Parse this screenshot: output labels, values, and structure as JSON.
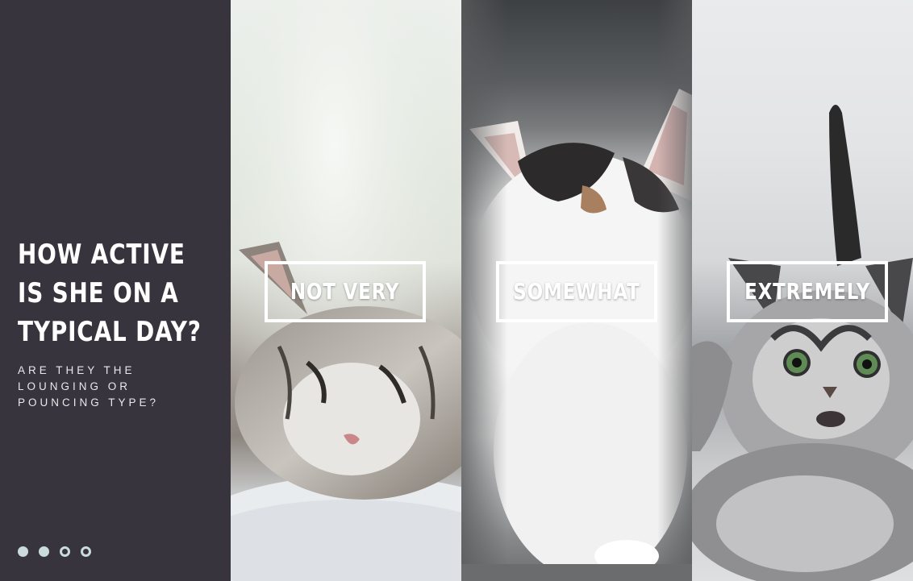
{
  "quiz": {
    "question": "HOW ACTIVE IS SHE ON A TYPICAL DAY?",
    "subtitle": "ARE THEY THE LOUNGING OR POUNCING TYPE?"
  },
  "pagination": {
    "total": 4,
    "current": 2,
    "dots": [
      "filled",
      "filled",
      "empty",
      "empty"
    ]
  },
  "options": [
    {
      "label": "NOT VERY",
      "image": "sleeping-kitten-photo"
    },
    {
      "label": "SOMEWHAT",
      "image": "walking-kitten-photo"
    },
    {
      "label": "EXTREMELY",
      "image": "pouncing-kitten-photo"
    }
  ],
  "colors": {
    "sidebar_background": "#38343d",
    "dot_color": "#c9dcdb",
    "button_border": "#ffffff"
  }
}
